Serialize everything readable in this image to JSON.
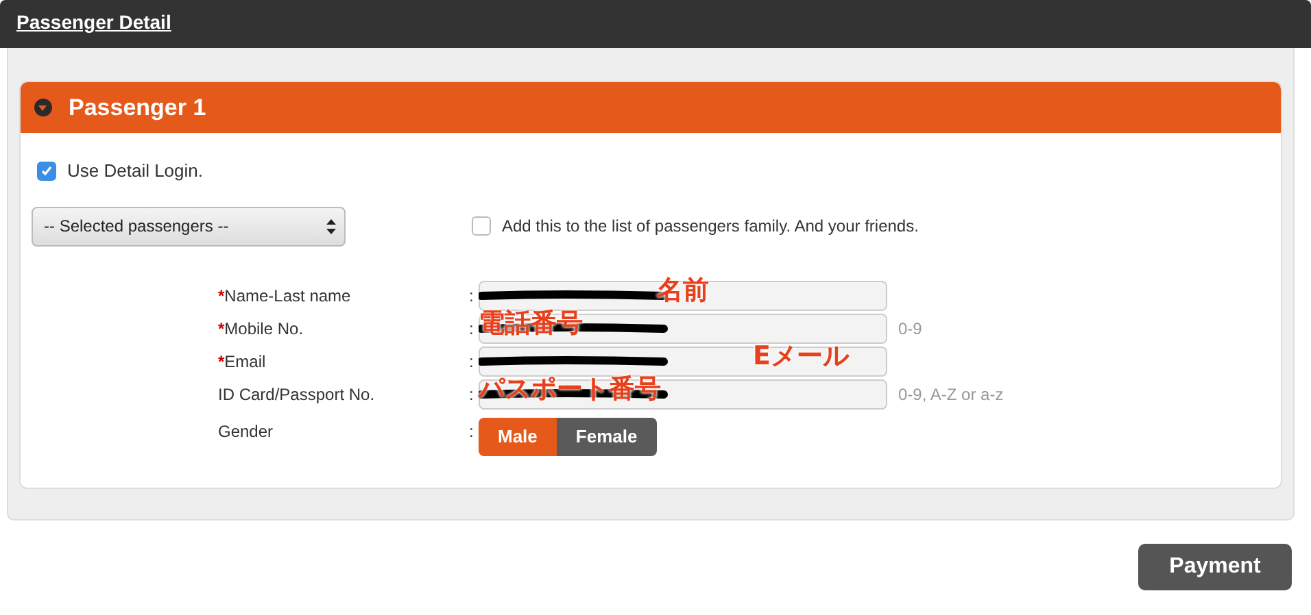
{
  "header": {
    "title": "Passenger Detail"
  },
  "panel": {
    "title": "Passenger 1",
    "expanded": true
  },
  "use_detail_login": {
    "label": "Use Detail Login.",
    "checked": true
  },
  "passenger_select": {
    "value": "-- Selected passengers --"
  },
  "add_to_list": {
    "label": "Add this to the list of passengers family. And your friends.",
    "checked": false
  },
  "fields": [
    {
      "required_mark": "*",
      "label": "Name-Last name",
      "redacted": true,
      "annotation": {
        "text": "名前",
        "kind": "middle"
      }
    },
    {
      "required_mark": "*",
      "label": "Mobile No.",
      "hint": "0-9",
      "redacted": true,
      "annotation": {
        "text": "電話番号",
        "kind": "start"
      }
    },
    {
      "required_mark": "*",
      "label": "Email",
      "redacted": true,
      "annotation": {
        "text": "Eメール",
        "kind": "end"
      }
    },
    {
      "label": "ID Card/Passport No.",
      "hint": "0-9, A-Z or a-z",
      "redacted": true,
      "annotation": {
        "text": "パスポート番号",
        "kind": "start"
      }
    }
  ],
  "gender": {
    "label": "Gender",
    "options": [
      {
        "label": "Male",
        "selected": true
      },
      {
        "label": "Female",
        "selected": false
      }
    ]
  },
  "separator": ":",
  "buttons": [
    {
      "label": "Payment"
    }
  ]
}
